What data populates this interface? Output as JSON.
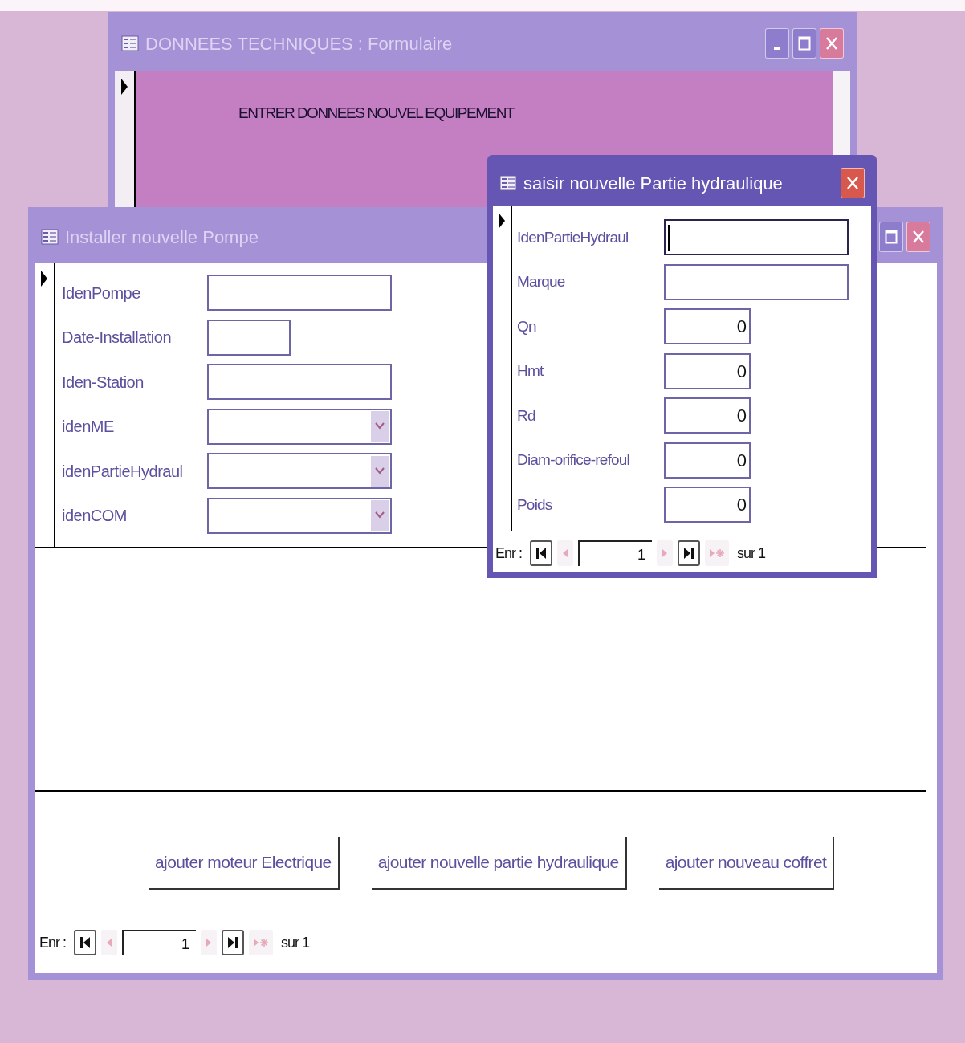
{
  "technical_data_window": {
    "title": "DONNEES TECHNIQUES : Formulaire",
    "active": false,
    "controls": [
      {
        "kind": "minimize"
      },
      {
        "kind": "maximize"
      },
      {
        "kind": "close"
      }
    ],
    "heading": "ENTRER DONNEES NOUVEL EQUIPEMENT"
  },
  "pump_window": {
    "title": "Installer nouvelle Pompe",
    "active": false,
    "controls": [
      {
        "kind": "maximize"
      },
      {
        "kind": "close"
      }
    ],
    "fields": [
      {
        "label": "IdenPompe",
        "kind": "text"
      },
      {
        "label": "Date-Installation",
        "kind": "date"
      },
      {
        "label": "Iden-Station",
        "kind": "text"
      },
      {
        "label": "idenME",
        "kind": "combo"
      },
      {
        "label": "idenPartieHydraul",
        "kind": "combo"
      },
      {
        "label": "idenCOM",
        "kind": "combo"
      }
    ],
    "actions": [
      "ajouter moteur Electrique",
      "ajouter nouvelle partie hydraulique",
      "ajouter nouveau coffret"
    ],
    "navigator": {
      "label": "Enr :",
      "current": "1",
      "total": "sur 1",
      "buttons": [
        {
          "kind": "first",
          "disabled": false
        },
        {
          "kind": "prev",
          "disabled": true
        },
        {
          "kind": "next",
          "disabled": true
        },
        {
          "kind": "last",
          "disabled": false
        },
        {
          "kind": "new",
          "disabled": true
        }
      ]
    }
  },
  "hydraulic_window": {
    "title": "saisir nouvelle Partie hydraulique",
    "active": true,
    "controls": [
      {
        "kind": "close"
      }
    ],
    "fields": [
      {
        "label": "IdenPartieHydraul",
        "kind": "text",
        "focused": true
      },
      {
        "label": "Marque",
        "kind": "text",
        "focused": false
      },
      {
        "label": "Qn",
        "kind": "number",
        "value": "0",
        "focused": false
      },
      {
        "label": "Hmt",
        "kind": "number",
        "value": "0",
        "focused": false
      },
      {
        "label": "Rd",
        "kind": "number",
        "value": "0",
        "focused": false
      },
      {
        "label": "Diam-orifice-refoul",
        "kind": "number",
        "value": "0",
        "focused": false
      },
      {
        "label": "Poids",
        "kind": "number",
        "value": "0",
        "focused": false
      }
    ],
    "navigator": {
      "label": "Enr :",
      "current": "1",
      "total": "sur 1",
      "buttons": [
        {
          "kind": "first",
          "disabled": false
        },
        {
          "kind": "prev",
          "disabled": true
        },
        {
          "kind": "next",
          "disabled": true
        },
        {
          "kind": "last",
          "disabled": false
        },
        {
          "kind": "new",
          "disabled": true
        }
      ]
    }
  }
}
